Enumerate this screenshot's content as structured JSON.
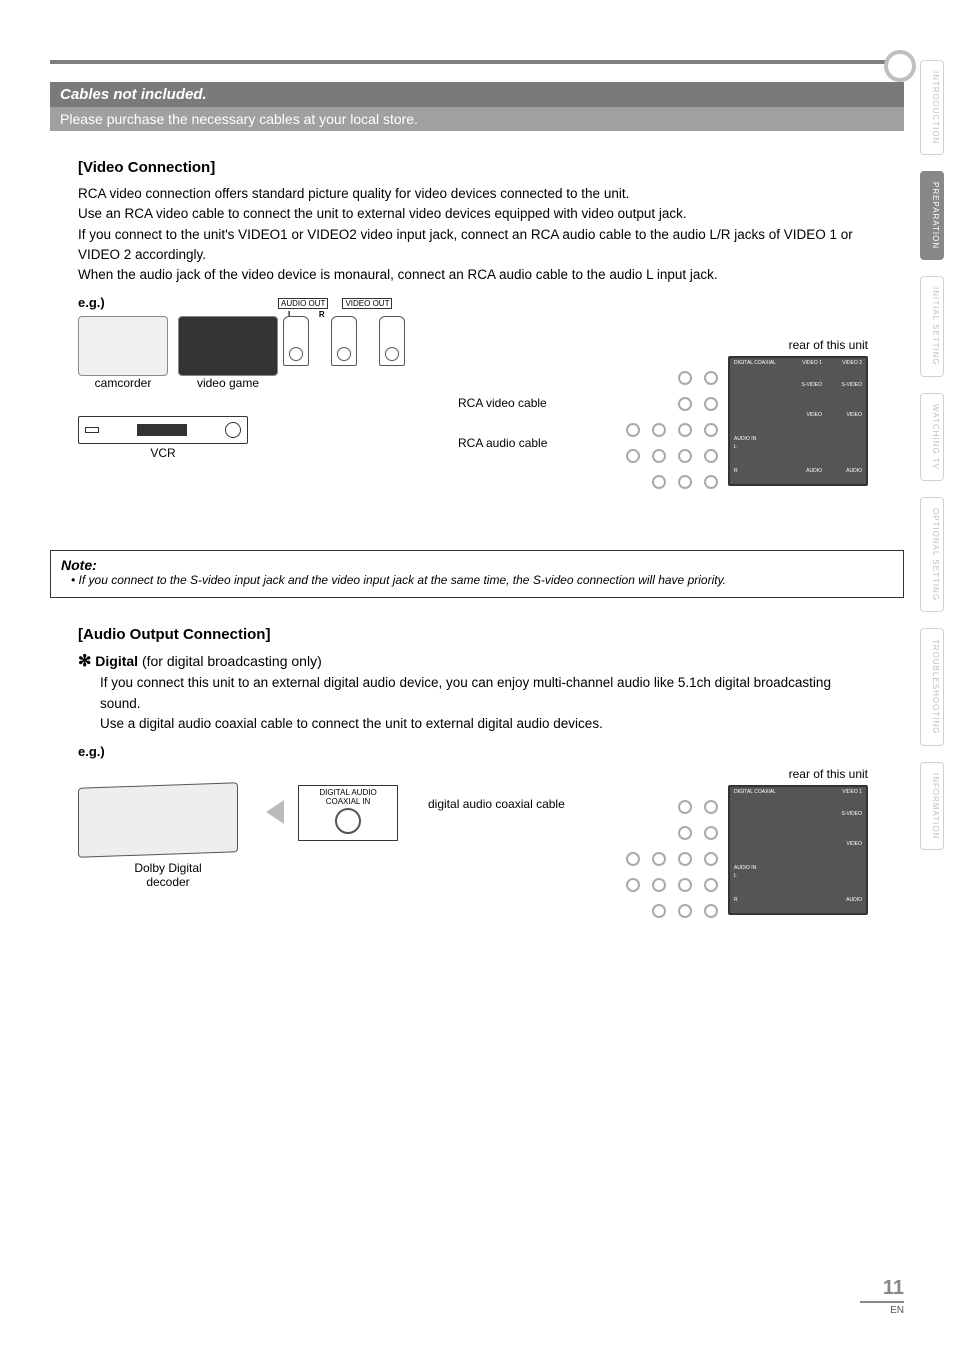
{
  "banner": {
    "title": "Cables not included.",
    "subtitle": "Please purchase the necessary cables at your local store."
  },
  "video_section": {
    "heading": "[Video Connection]",
    "p1": "RCA video connection offers standard picture quality for video devices connected to the unit.",
    "p2": "Use an RCA video cable to connect the unit to external video devices equipped with video output jack.",
    "p3": "If you connect to the unit's VIDEO1 or VIDEO2 video input jack, connect an RCA audio cable to the audio L/R jacks of VIDEO 1 or VIDEO 2 accordingly.",
    "p4": "When the audio jack of the video device is monaural, connect an RCA audio cable to the audio L input jack.",
    "eg": "e.g.)",
    "diagram": {
      "camcorder": "camcorder",
      "videogame": "video game",
      "vcr": "VCR",
      "audio_out": "AUDIO OUT",
      "L": "L",
      "R": "R",
      "video_out": "VIDEO OUT",
      "rca_video": "RCA video cable",
      "rca_audio": "RCA audio cable",
      "rear": "rear of this unit",
      "jack_labels": {
        "digital_coaxial": "DIGITAL COAXIAL",
        "video1": "VIDEO 1",
        "video2": "VIDEO 2",
        "svideo": "S-VIDEO",
        "video": "VIDEO",
        "audio_in": "AUDIO IN",
        "audio": "AUDIO",
        "l": "L",
        "r": "R"
      }
    }
  },
  "note": {
    "title": "Note:",
    "body": "If you connect to the S-video input jack and the video input jack at the same time, the S-video connection will have priority."
  },
  "audio_section": {
    "heading": "[Audio Output Connection]",
    "star": "✻",
    "digital_bold": "Digital",
    "digital_rest": " (for digital broadcasting only)",
    "p1": "If you connect this unit to an external digital audio device, you can enjoy multi-channel audio like 5.1ch digital broadcasting sound.",
    "p2": "Use a digital audio coaxial cable to connect the unit to external digital audio devices.",
    "eg": "e.g.)",
    "diagram": {
      "decoder_l1": "Dolby Digital",
      "decoder_l2": "decoder",
      "coax_label_l1": "DIGITAL AUDIO",
      "coax_label_l2": "COAXIAL IN",
      "coax_cable": "digital audio coaxial cable",
      "rear": "rear of this unit"
    }
  },
  "sidetabs": [
    "INTRODUCTION",
    "PREPARATION",
    "INITIAL SETTING",
    "WATCHING TV",
    "OPTIONAL SETTING",
    "TROUBLESHOOTING",
    "INFORMATION"
  ],
  "active_tab_index": 1,
  "footer": {
    "page": "11",
    "lang": "EN"
  }
}
